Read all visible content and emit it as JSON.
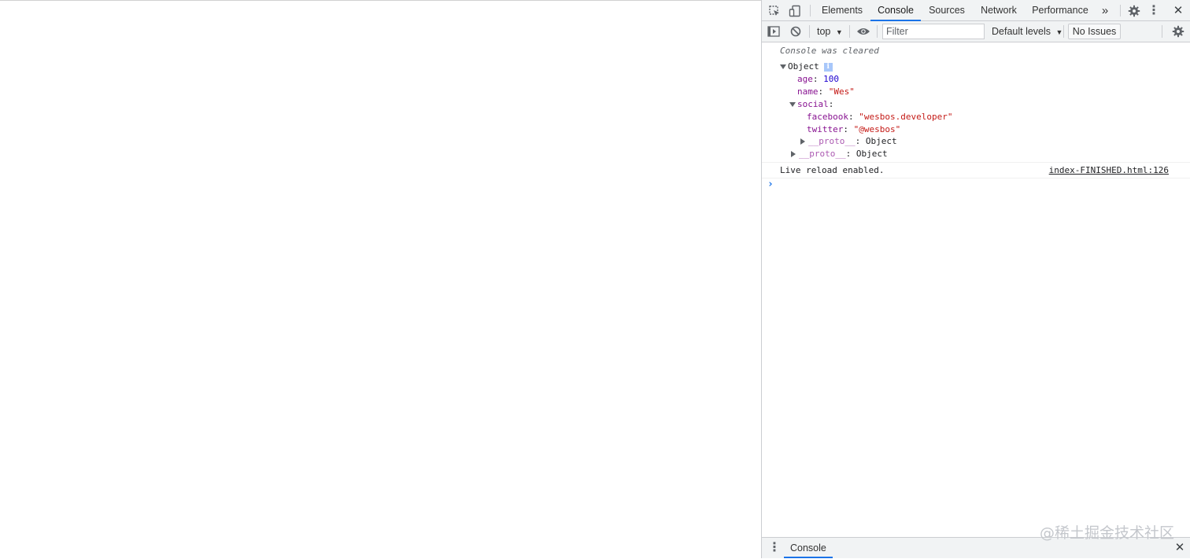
{
  "devtools": {
    "tabs": [
      {
        "label": "Elements"
      },
      {
        "label": "Console"
      },
      {
        "label": "Sources"
      },
      {
        "label": "Network"
      },
      {
        "label": "Performance"
      }
    ],
    "active_tab": "Console",
    "more_tabs_glyph": "»",
    "close_glyph": "✕",
    "kebab_glyph": "⋮"
  },
  "toolbar": {
    "context": "top",
    "filter_placeholder": "Filter",
    "levels": "Default levels",
    "issues": "No Issues"
  },
  "console": {
    "cleared": "Console was cleared",
    "object": {
      "label": "Object",
      "info_badge": "i",
      "age_key": "age",
      "age_value": "100",
      "name_key": "name",
      "name_value": "\"Wes\"",
      "social_key": "social",
      "facebook_key": "facebook",
      "facebook_value": "\"wesbos.developer\"",
      "twitter_key": "twitter",
      "twitter_value": "\"@wesbos\"",
      "proto_key": "__proto__",
      "proto_value": "Object"
    },
    "log_message": "Live reload enabled.",
    "log_source": "index-FINISHED.html:126",
    "prompt": "›"
  },
  "drawer": {
    "tab": "Console"
  },
  "watermark": "@稀土掘金技术社区",
  "colors": {
    "accent": "#1a73e8",
    "key": "#881391",
    "number": "#1c00cf",
    "string": "#c41a16"
  }
}
